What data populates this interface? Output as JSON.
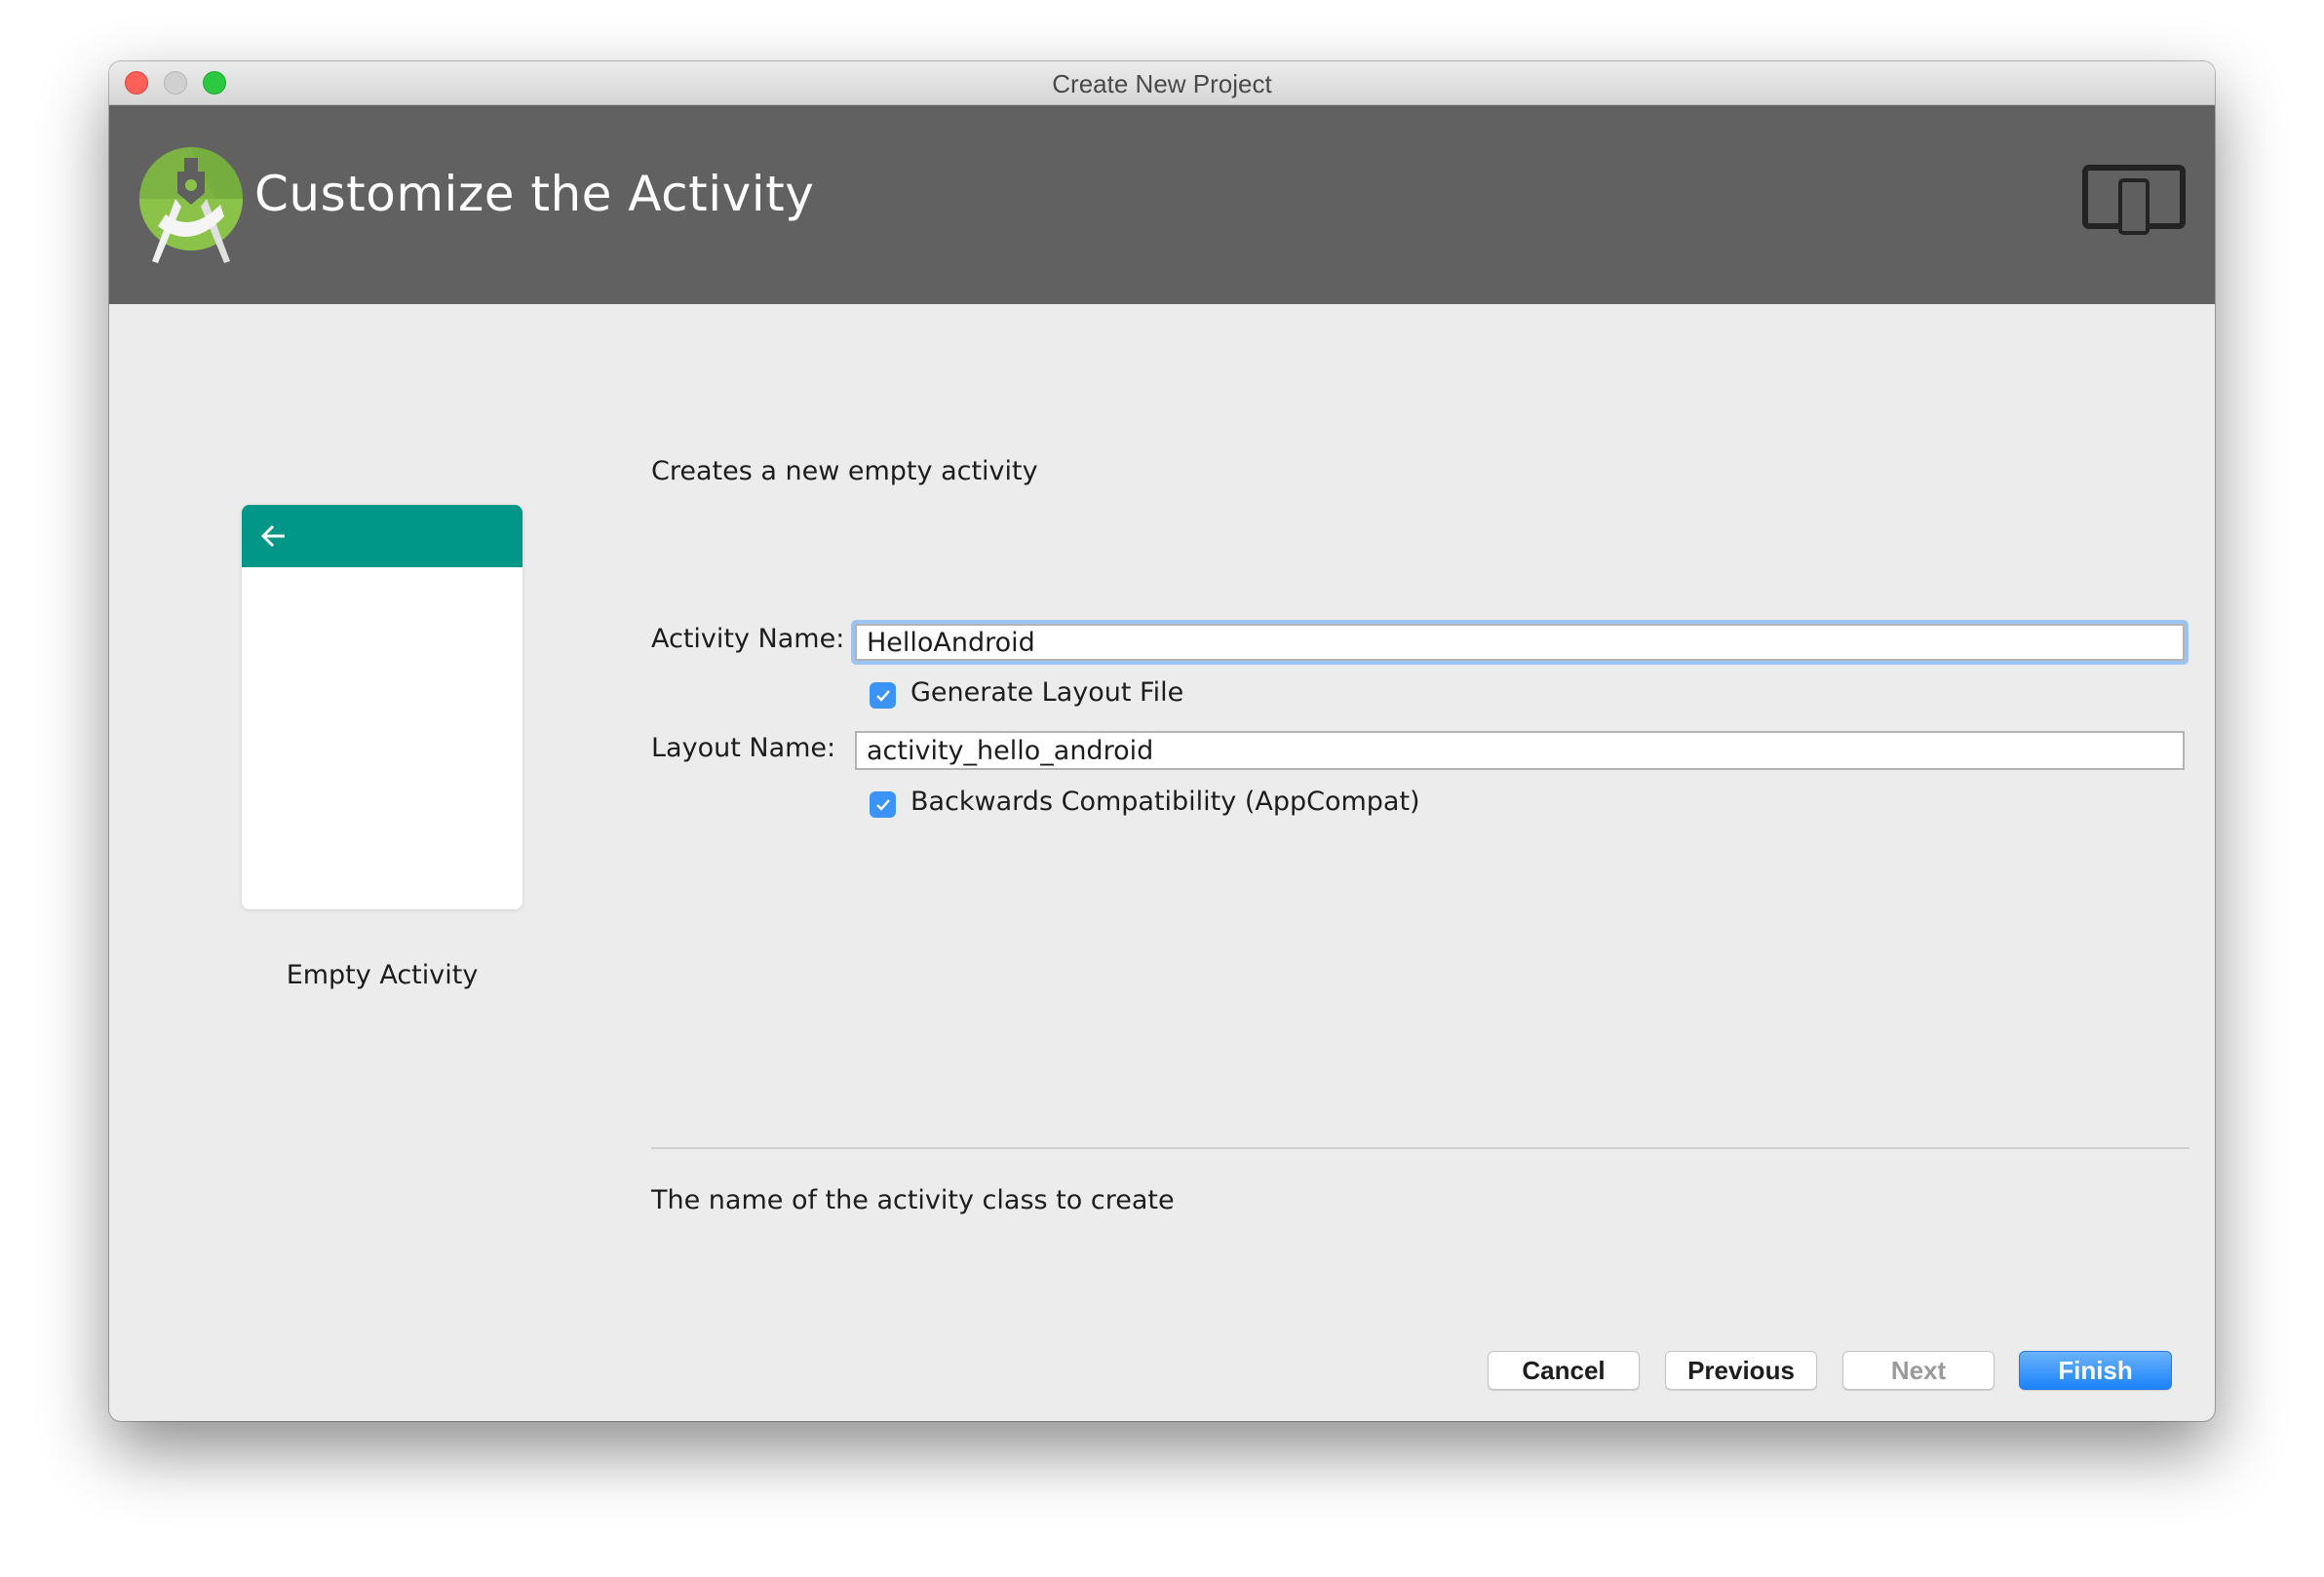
{
  "window": {
    "title": "Create New Project"
  },
  "header": {
    "title": "Customize the Activity",
    "logo_icon": "android-studio-logo",
    "device_icon": "tablet-phone-icon"
  },
  "preview": {
    "template_name": "Empty Activity",
    "toolbar_color": "#009688",
    "back_icon": "arrow-left-icon"
  },
  "form": {
    "description": "Creates a new empty activity",
    "activity_name": {
      "label": "Activity Name:",
      "value": "HelloAndroid"
    },
    "generate_layout": {
      "label": "Generate Layout File",
      "checked": true
    },
    "layout_name": {
      "label": "Layout Name:",
      "value": "activity_hello_android"
    },
    "backwards_compat": {
      "label": "Backwards Compatibility (AppCompat)",
      "checked": true
    },
    "help_text": "The name of the activity class to create"
  },
  "buttons": {
    "cancel": "Cancel",
    "previous": "Previous",
    "next": "Next",
    "finish": "Finish"
  },
  "colors": {
    "header_bg": "#616161",
    "accent": "#1a82fb",
    "checkbox": "#3b94f5",
    "focus_ring": "#9cc4f2"
  }
}
